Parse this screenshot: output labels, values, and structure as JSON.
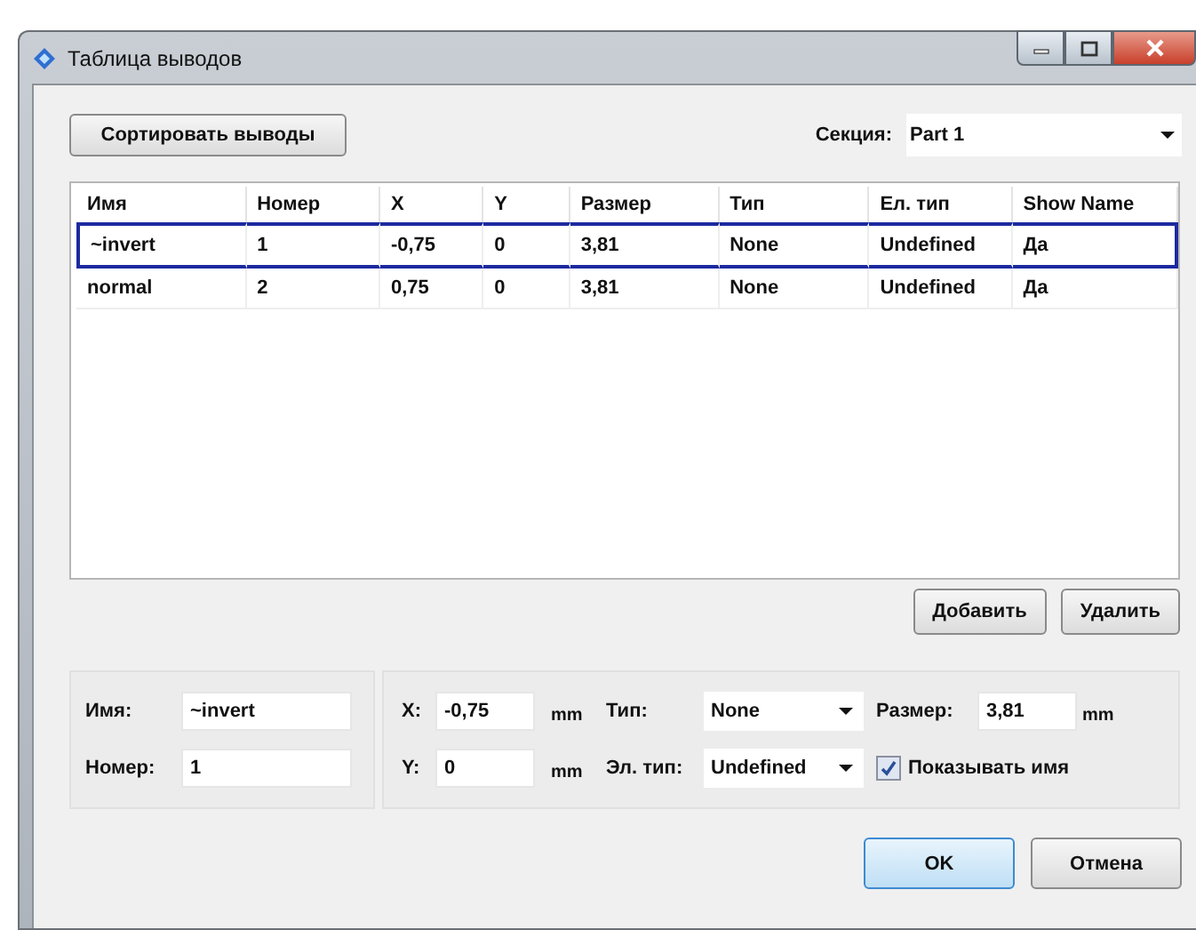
{
  "window": {
    "title": "Таблица выводов"
  },
  "sort_button": "Сортировать выводы",
  "section": {
    "label": "Секция:",
    "value": "Part 1"
  },
  "table": {
    "columns": [
      "Имя",
      "Номер",
      "X",
      "Y",
      "Размер",
      "Тип",
      "Ел. тип",
      "Show Name"
    ],
    "rows": [
      {
        "cells": [
          "~invert",
          "1",
          "-0,75",
          "0",
          "3,81",
          "None",
          "Undefined",
          "Да"
        ],
        "selected": true
      },
      {
        "cells": [
          "normal",
          "2",
          "0,75",
          "0",
          "3,81",
          "None",
          "Undefined",
          "Да"
        ],
        "selected": false
      }
    ]
  },
  "table_buttons": [
    "Добавить",
    "Удалить"
  ],
  "pin_form": {
    "name": {
      "label": "Имя:",
      "value": "~invert"
    },
    "number": {
      "label": "Номер:",
      "value": "1"
    },
    "x": {
      "label": "X:",
      "value": "-0,75",
      "unit": "mm"
    },
    "y": {
      "label": "Y:",
      "value": "0",
      "unit": "mm"
    },
    "type": {
      "label": "Тип:",
      "value": "None"
    },
    "el_type": {
      "label": "Эл. тип:",
      "value": "Undefined"
    },
    "size": {
      "label": "Размер:",
      "value": "3,81",
      "unit": "mm"
    },
    "show_name": {
      "label": "Показывать имя",
      "checked": true
    }
  },
  "dialog_buttons": [
    {
      "label": "OK",
      "default": true
    },
    {
      "label": "Отмена",
      "default": false
    }
  ]
}
